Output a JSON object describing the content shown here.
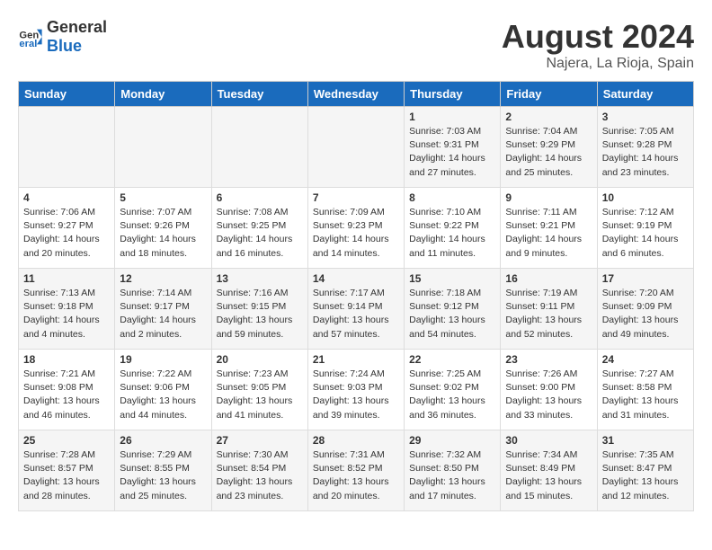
{
  "header": {
    "logo_general": "General",
    "logo_blue": "Blue",
    "month_year": "August 2024",
    "location": "Najera, La Rioja, Spain"
  },
  "days_of_week": [
    "Sunday",
    "Monday",
    "Tuesday",
    "Wednesday",
    "Thursday",
    "Friday",
    "Saturday"
  ],
  "weeks": [
    [
      {
        "day": "",
        "info": ""
      },
      {
        "day": "",
        "info": ""
      },
      {
        "day": "",
        "info": ""
      },
      {
        "day": "",
        "info": ""
      },
      {
        "day": "1",
        "info": "Sunrise: 7:03 AM\nSunset: 9:31 PM\nDaylight: 14 hours and 27 minutes."
      },
      {
        "day": "2",
        "info": "Sunrise: 7:04 AM\nSunset: 9:29 PM\nDaylight: 14 hours and 25 minutes."
      },
      {
        "day": "3",
        "info": "Sunrise: 7:05 AM\nSunset: 9:28 PM\nDaylight: 14 hours and 23 minutes."
      }
    ],
    [
      {
        "day": "4",
        "info": "Sunrise: 7:06 AM\nSunset: 9:27 PM\nDaylight: 14 hours and 20 minutes."
      },
      {
        "day": "5",
        "info": "Sunrise: 7:07 AM\nSunset: 9:26 PM\nDaylight: 14 hours and 18 minutes."
      },
      {
        "day": "6",
        "info": "Sunrise: 7:08 AM\nSunset: 9:25 PM\nDaylight: 14 hours and 16 minutes."
      },
      {
        "day": "7",
        "info": "Sunrise: 7:09 AM\nSunset: 9:23 PM\nDaylight: 14 hours and 14 minutes."
      },
      {
        "day": "8",
        "info": "Sunrise: 7:10 AM\nSunset: 9:22 PM\nDaylight: 14 hours and 11 minutes."
      },
      {
        "day": "9",
        "info": "Sunrise: 7:11 AM\nSunset: 9:21 PM\nDaylight: 14 hours and 9 minutes."
      },
      {
        "day": "10",
        "info": "Sunrise: 7:12 AM\nSunset: 9:19 PM\nDaylight: 14 hours and 6 minutes."
      }
    ],
    [
      {
        "day": "11",
        "info": "Sunrise: 7:13 AM\nSunset: 9:18 PM\nDaylight: 14 hours and 4 minutes."
      },
      {
        "day": "12",
        "info": "Sunrise: 7:14 AM\nSunset: 9:17 PM\nDaylight: 14 hours and 2 minutes."
      },
      {
        "day": "13",
        "info": "Sunrise: 7:16 AM\nSunset: 9:15 PM\nDaylight: 13 hours and 59 minutes."
      },
      {
        "day": "14",
        "info": "Sunrise: 7:17 AM\nSunset: 9:14 PM\nDaylight: 13 hours and 57 minutes."
      },
      {
        "day": "15",
        "info": "Sunrise: 7:18 AM\nSunset: 9:12 PM\nDaylight: 13 hours and 54 minutes."
      },
      {
        "day": "16",
        "info": "Sunrise: 7:19 AM\nSunset: 9:11 PM\nDaylight: 13 hours and 52 minutes."
      },
      {
        "day": "17",
        "info": "Sunrise: 7:20 AM\nSunset: 9:09 PM\nDaylight: 13 hours and 49 minutes."
      }
    ],
    [
      {
        "day": "18",
        "info": "Sunrise: 7:21 AM\nSunset: 9:08 PM\nDaylight: 13 hours and 46 minutes."
      },
      {
        "day": "19",
        "info": "Sunrise: 7:22 AM\nSunset: 9:06 PM\nDaylight: 13 hours and 44 minutes."
      },
      {
        "day": "20",
        "info": "Sunrise: 7:23 AM\nSunset: 9:05 PM\nDaylight: 13 hours and 41 minutes."
      },
      {
        "day": "21",
        "info": "Sunrise: 7:24 AM\nSunset: 9:03 PM\nDaylight: 13 hours and 39 minutes."
      },
      {
        "day": "22",
        "info": "Sunrise: 7:25 AM\nSunset: 9:02 PM\nDaylight: 13 hours and 36 minutes."
      },
      {
        "day": "23",
        "info": "Sunrise: 7:26 AM\nSunset: 9:00 PM\nDaylight: 13 hours and 33 minutes."
      },
      {
        "day": "24",
        "info": "Sunrise: 7:27 AM\nSunset: 8:58 PM\nDaylight: 13 hours and 31 minutes."
      }
    ],
    [
      {
        "day": "25",
        "info": "Sunrise: 7:28 AM\nSunset: 8:57 PM\nDaylight: 13 hours and 28 minutes."
      },
      {
        "day": "26",
        "info": "Sunrise: 7:29 AM\nSunset: 8:55 PM\nDaylight: 13 hours and 25 minutes."
      },
      {
        "day": "27",
        "info": "Sunrise: 7:30 AM\nSunset: 8:54 PM\nDaylight: 13 hours and 23 minutes."
      },
      {
        "day": "28",
        "info": "Sunrise: 7:31 AM\nSunset: 8:52 PM\nDaylight: 13 hours and 20 minutes."
      },
      {
        "day": "29",
        "info": "Sunrise: 7:32 AM\nSunset: 8:50 PM\nDaylight: 13 hours and 17 minutes."
      },
      {
        "day": "30",
        "info": "Sunrise: 7:34 AM\nSunset: 8:49 PM\nDaylight: 13 hours and 15 minutes."
      },
      {
        "day": "31",
        "info": "Sunrise: 7:35 AM\nSunset: 8:47 PM\nDaylight: 13 hours and 12 minutes."
      }
    ]
  ]
}
